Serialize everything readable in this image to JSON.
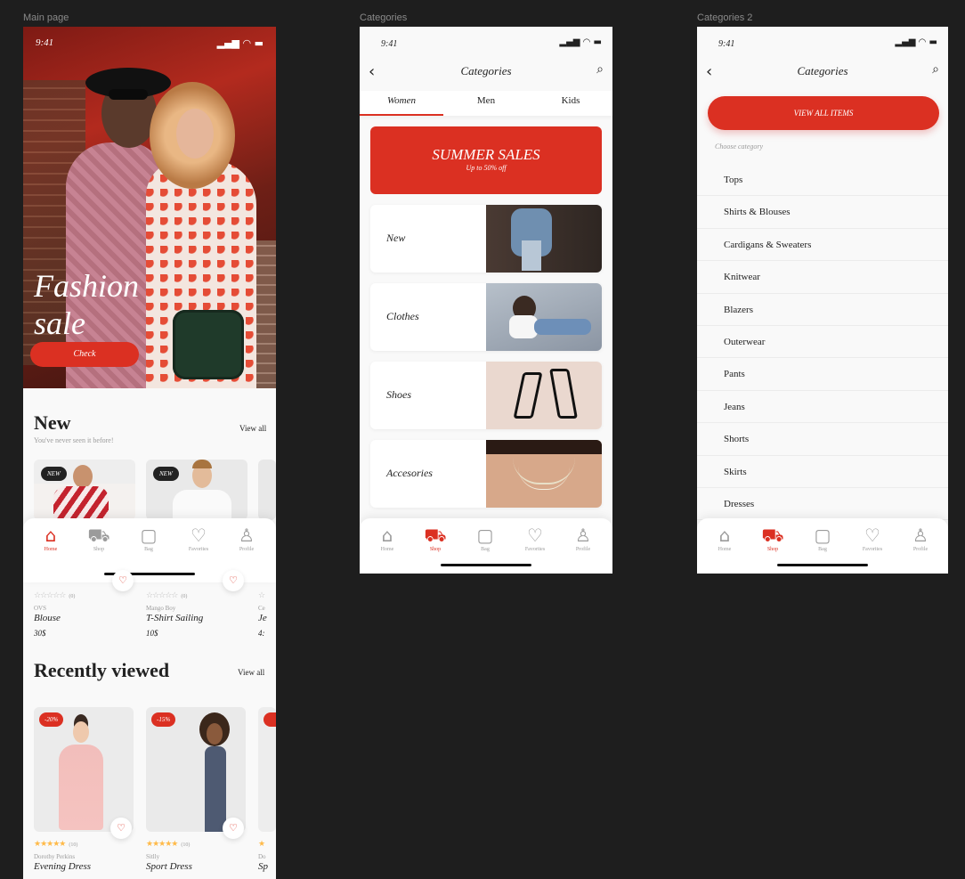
{
  "frames": {
    "main": "Main page",
    "cat1": "Categories",
    "cat2": "Categories 2"
  },
  "status": {
    "time": "9:41",
    "icons": "▂▄▆ ◠ ▬"
  },
  "main": {
    "hero_title_1": "Fashion",
    "hero_title_2": "sale",
    "check": "Check",
    "new_title": "New",
    "new_sub": "You've never seen it before!",
    "view_all": "View all",
    "new_badge": "NEW",
    "products": [
      {
        "brand": "OVS",
        "name": "Blouse",
        "price": "30$",
        "rating": "(0)"
      },
      {
        "brand": "Mango Boy",
        "name": "T-Shirt Sailing",
        "price": "10$",
        "rating": "(0)"
      },
      {
        "brand": "Ce",
        "name": "Je",
        "price": "4:",
        "rating": ""
      }
    ],
    "recent_title": "Recently viewed",
    "recent": [
      {
        "discount": "-20%",
        "brand": "Dorothy Perkins",
        "name": "Evening Dress",
        "rating": "(10)"
      },
      {
        "discount": "-15%",
        "brand": "Sitlly",
        "name": "Sport Dress",
        "rating": "(10)"
      },
      {
        "discount": "",
        "brand": "Do",
        "name": "Sp",
        "rating": ""
      }
    ]
  },
  "tabs": [
    {
      "label": "Home",
      "icon": "home-icon"
    },
    {
      "label": "Shop",
      "icon": "cart-icon"
    },
    {
      "label": "Bag",
      "icon": "bag-icon"
    },
    {
      "label": "Favorites",
      "icon": "heart-icon"
    },
    {
      "label": "Profile",
      "icon": "profile-icon"
    }
  ],
  "cat1": {
    "title": "Categories",
    "segments": [
      "Women",
      "Men",
      "Kids"
    ],
    "banner_title": "SUMMER SALES",
    "banner_sub": "Up to 50% off",
    "cards": [
      "New",
      "Clothes",
      "Shoes",
      "Accesories"
    ]
  },
  "cat2": {
    "title": "Categories",
    "view_all_items": "VIEW ALL ITEMS",
    "choose": "Choose category",
    "items": [
      "Tops",
      "Shirts & Blouses",
      "Cardigans & Sweaters",
      "Knitwear",
      "Blazers",
      "Outerwear",
      "Pants",
      "Jeans",
      "Shorts",
      "Skirts",
      "Dresses"
    ]
  },
  "colors": {
    "accent": "#DB3022",
    "star": "#FFBA49",
    "muted": "#9B9B9B"
  }
}
